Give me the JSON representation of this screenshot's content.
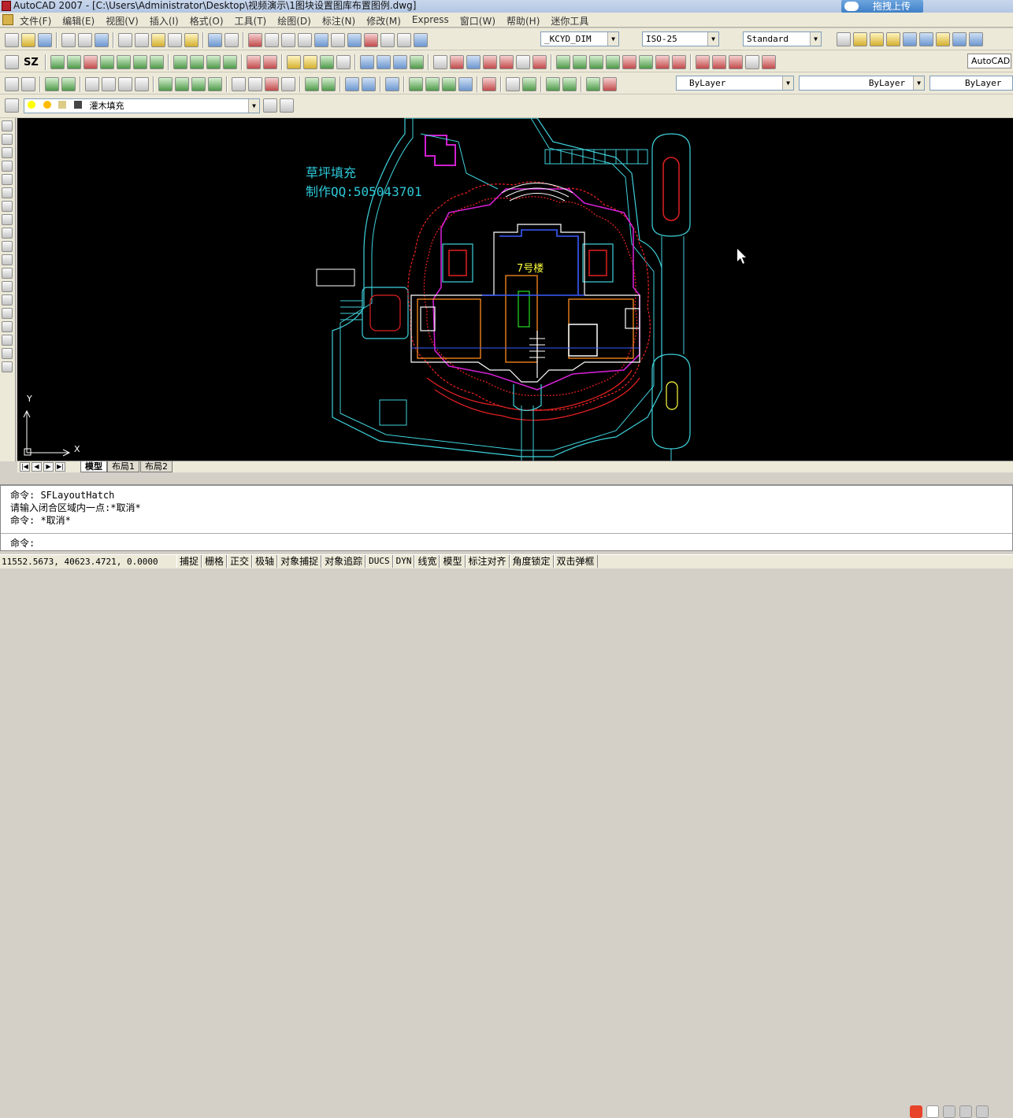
{
  "window": {
    "title": "AutoCAD 2007 - [C:\\Users\\Administrator\\Desktop\\视频演示\\1图块设置图库布置图例.dwg]",
    "upload_button": "拖拽上传"
  },
  "menu": [
    "文件(F)",
    "编辑(E)",
    "视图(V)",
    "插入(I)",
    "格式(O)",
    "工具(T)",
    "绘图(D)",
    "标注(N)",
    "修改(M)",
    "Express",
    "窗口(W)",
    "帮助(H)",
    "迷你工具"
  ],
  "toolbar": {
    "text_style": "_KCYD_DIM",
    "dim_style": "ISO-25",
    "table_style": "Standard",
    "workspace": "AutoCAD 经典",
    "layer": "灌木填充",
    "color": "ByLayer",
    "linetype": "ByLayer",
    "lineweight": "ByLayer",
    "sz_label": "SZ"
  },
  "drawing": {
    "annotation_line1": "草坪填充",
    "annotation_line2": "制作QQ:505043701",
    "building_label": "7号楼",
    "ucs_y": "Y",
    "ucs_x": "X"
  },
  "tabs": [
    "模型",
    "布局1",
    "布局2"
  ],
  "command": {
    "lines": [
      "命令: SFLayoutHatch",
      "请输入闭合区域内一点:*取消*",
      "命令: *取消*"
    ],
    "prompt": "命令:"
  },
  "status": {
    "coords": "11552.5673, 40623.4721, 0.0000",
    "toggles": [
      "捕捉",
      "栅格",
      "正交",
      "极轴",
      "对象捕捉",
      "对象追踪",
      "DUCS",
      "DYN",
      "线宽",
      "模型",
      "标注对齐",
      "角度锁定",
      "双击弹框"
    ]
  },
  "colors": {
    "canvas_bg": "#000000",
    "cad_text": "#2ec9d8",
    "cyan_lines": "#3fd2dc",
    "red_hatch": "#e02020",
    "magenta": "#d020d0",
    "building_label": "#ffff40"
  }
}
